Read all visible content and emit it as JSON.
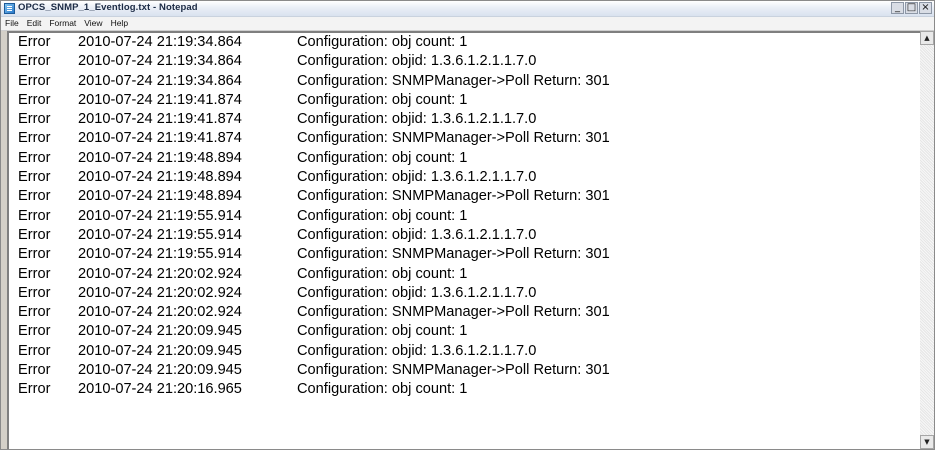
{
  "window": {
    "title": "OPCS_SNMP_1_Eventlog.txt - Notepad",
    "buttons": {
      "minimize": "_",
      "maximize": "□",
      "close": "×"
    }
  },
  "menu": [
    {
      "label": "File"
    },
    {
      "label": "Edit"
    },
    {
      "label": "Format"
    },
    {
      "label": "View"
    },
    {
      "label": "Help"
    }
  ],
  "log_lines": [
    {
      "level": "Error",
      "timestamp": "2010-07-24 21:19:34.864",
      "message": "Configuration: obj count: 1"
    },
    {
      "level": "Error",
      "timestamp": "2010-07-24 21:19:34.864",
      "message": "Configuration: objid: 1.3.6.1.2.1.1.7.0"
    },
    {
      "level": "Error",
      "timestamp": "2010-07-24 21:19:34.864",
      "message": "Configuration: SNMPManager->Poll Return: 301"
    },
    {
      "level": "Error",
      "timestamp": "2010-07-24 21:19:41.874",
      "message": "Configuration: obj count: 1"
    },
    {
      "level": "Error",
      "timestamp": "2010-07-24 21:19:41.874",
      "message": "Configuration: objid: 1.3.6.1.2.1.1.7.0"
    },
    {
      "level": "Error",
      "timestamp": "2010-07-24 21:19:41.874",
      "message": "Configuration: SNMPManager->Poll Return: 301"
    },
    {
      "level": "Error",
      "timestamp": "2010-07-24 21:19:48.894",
      "message": "Configuration: obj count: 1"
    },
    {
      "level": "Error",
      "timestamp": "2010-07-24 21:19:48.894",
      "message": "Configuration: objid: 1.3.6.1.2.1.1.7.0"
    },
    {
      "level": "Error",
      "timestamp": "2010-07-24 21:19:48.894",
      "message": "Configuration: SNMPManager->Poll Return: 301"
    },
    {
      "level": "Error",
      "timestamp": "2010-07-24 21:19:55.914",
      "message": "Configuration: obj count: 1"
    },
    {
      "level": "Error",
      "timestamp": "2010-07-24 21:19:55.914",
      "message": "Configuration: objid: 1.3.6.1.2.1.1.7.0"
    },
    {
      "level": "Error",
      "timestamp": "2010-07-24 21:19:55.914",
      "message": "Configuration: SNMPManager->Poll Return: 301"
    },
    {
      "level": "Error",
      "timestamp": "2010-07-24 21:20:02.924",
      "message": "Configuration: obj count: 1"
    },
    {
      "level": "Error",
      "timestamp": "2010-07-24 21:20:02.924",
      "message": "Configuration: objid: 1.3.6.1.2.1.1.7.0"
    },
    {
      "level": "Error",
      "timestamp": "2010-07-24 21:20:02.924",
      "message": "Configuration: SNMPManager->Poll Return: 301"
    },
    {
      "level": "Error",
      "timestamp": "2010-07-24 21:20:09.945",
      "message": "Configuration: obj count: 1"
    },
    {
      "level": "Error",
      "timestamp": "2010-07-24 21:20:09.945",
      "message": "Configuration: objid: 1.3.6.1.2.1.1.7.0"
    },
    {
      "level": "Error",
      "timestamp": "2010-07-24 21:20:09.945",
      "message": "Configuration: SNMPManager->Poll Return: 301"
    },
    {
      "level": "Error",
      "timestamp": "2010-07-24 21:20:16.965",
      "message": "Configuration: obj count: 1"
    }
  ],
  "scrollbar": {
    "up_arrow": "▲",
    "down_arrow": "▼"
  }
}
